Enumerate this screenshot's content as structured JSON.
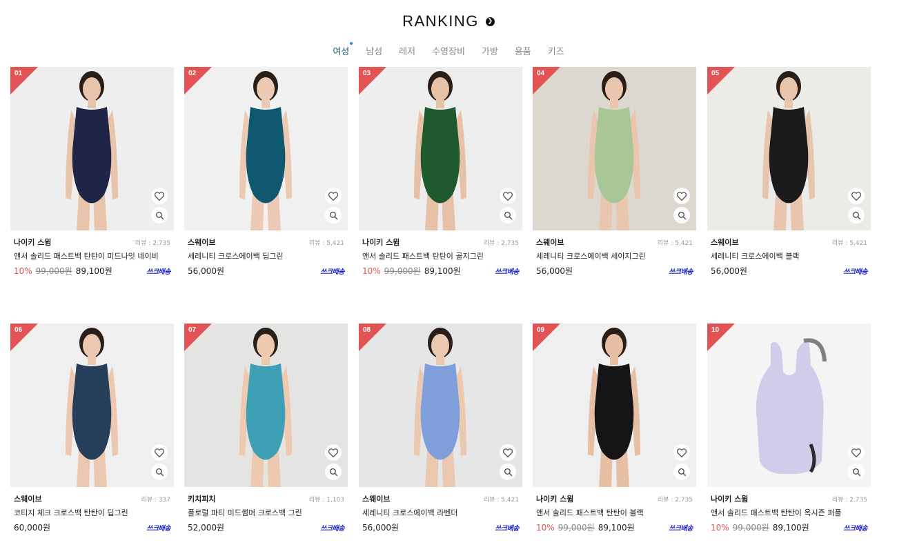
{
  "header": {
    "title": "RANKING",
    "arrow_icon": "chevron-right-circle-icon"
  },
  "tabs": [
    {
      "label": "여성",
      "active": true
    },
    {
      "label": "남성"
    },
    {
      "label": "레저"
    },
    {
      "label": "수영장비"
    },
    {
      "label": "가방"
    },
    {
      "label": "용품"
    },
    {
      "label": "키즈"
    }
  ],
  "colors": {
    "accent_red": "#e35353",
    "delivery_blue": "#1a24c9",
    "tab_active": "#1d5b77"
  },
  "products": [
    {
      "rank": "01",
      "brand": "나이키 스윔",
      "review": "리뷰 : 2,735",
      "name": "앤서 솔리드 패스트백 탄탄이 미드나잇 네이비",
      "discount": "10%",
      "orig": "99,000원",
      "price": "89,100원",
      "delivery": "쓰크배송",
      "suit": "#1e2547",
      "bg": "#eeeeee",
      "skin": "#e8c4ab"
    },
    {
      "rank": "02",
      "brand": "스웨이브",
      "review": "리뷰 : 5,421",
      "name": "세레니티 크로스에이백 딥그린",
      "discount": "",
      "orig": "",
      "price": "56,000원",
      "delivery": "쓰크배송",
      "suit": "#0f5870",
      "bg": "#f0f0f0",
      "skin": "#ecc9b3"
    },
    {
      "rank": "03",
      "brand": "나이키 스윔",
      "review": "리뷰 : 2,735",
      "name": "앤서 솔리드 패스트백 탄탄이 골지그린",
      "discount": "10%",
      "orig": "99,000원",
      "price": "89,100원",
      "delivery": "쓰크배송",
      "suit": "#1f5a2e",
      "bg": "#ededed",
      "skin": "#e6c1a6"
    },
    {
      "rank": "04",
      "brand": "스웨이브",
      "review": "리뷰 : 5,421",
      "name": "세레니티 크로스에이백 세이지그린",
      "discount": "",
      "orig": "",
      "price": "56,000원",
      "delivery": "쓰크배송",
      "suit": "#a9c796",
      "bg": "#ddd8cf",
      "skin": "#e9c6ad"
    },
    {
      "rank": "05",
      "brand": "스웨이브",
      "review": "리뷰 : 5,421",
      "name": "세레니티 크로스에이백 블랙",
      "discount": "",
      "orig": "",
      "price": "56,000원",
      "delivery": "쓰크배송",
      "suit": "#1b1b1d",
      "bg": "#ebebe8",
      "skin": "#e8c5ad"
    },
    {
      "rank": "06",
      "brand": "스웨이브",
      "review": "리뷰 : 337",
      "name": "코티지 체크 크로스백 탄탄이 딥그린",
      "discount": "",
      "orig": "",
      "price": "60,000원",
      "delivery": "쓰크배송",
      "suit": "#253e5a",
      "bg": "#efefef",
      "skin": "#ecc8b1"
    },
    {
      "rank": "07",
      "brand": "키치피치",
      "review": "리뷰 : 1,103",
      "name": "플로럴 파티 미드썸머 크로스백 그린",
      "discount": "",
      "orig": "",
      "price": "52,000원",
      "delivery": "쓰크배송",
      "suit": "#3f9fb4",
      "bg": "#e4e4e2",
      "skin": "#eec9af"
    },
    {
      "rank": "08",
      "brand": "스웨이브",
      "review": "리뷰 : 5,421",
      "name": "세레니티 크로스에이백 라벤더",
      "discount": "",
      "orig": "",
      "price": "56,000원",
      "delivery": "쓰크배송",
      "suit": "#7e9fd9",
      "bg": "#e6e6e6",
      "skin": "#ebc8b0"
    },
    {
      "rank": "09",
      "brand": "나이키 스윔",
      "review": "리뷰 : 2,735",
      "name": "앤서 솔리드 패스트백 탄탄이 블랙",
      "discount": "10%",
      "orig": "99,000원",
      "price": "89,100원",
      "delivery": "쓰크배송",
      "suit": "#151517",
      "bg": "#efefef",
      "skin": "#e7c0a4"
    },
    {
      "rank": "10",
      "brand": "나이키 스윔",
      "review": "리뷰 : 2,735",
      "name": "앤서 솔리드 패스트백 탄탄이 옥시즌 퍼플",
      "discount": "10%",
      "orig": "99,000원",
      "price": "89,100원",
      "delivery": "쓰크배송",
      "suit": "#cfcdea",
      "bg": "#f4f4f4",
      "skin": ""
    }
  ]
}
